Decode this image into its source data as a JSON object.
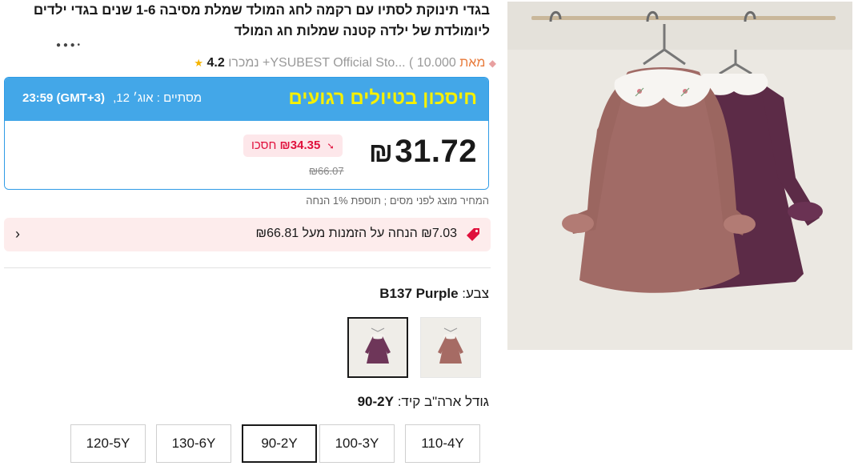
{
  "product": {
    "title": "בגדי תינוקת לסתיו עם רקמה לחג המולד שמלת מסיבה 1-6 שנים בגדי ילדים ליומולדת של ילדה קטנה שמלות חג המולד",
    "sold": "( 10.000+ נמכרו",
    "rating": "4.2",
    "store_name": "YSUBEST Official Sto...",
    "store_suffix": "מאת"
  },
  "sale": {
    "title": "חיסכון בטיולים רגועים",
    "ends_label": "מסתיים : אוג׳ 12,",
    "ends_time": "23:59 (GMT+3)",
    "price": "31.72",
    "currency": "₪",
    "save_amount": "₪34.35",
    "save_label": "חסכו",
    "old_price": "₪66.07"
  },
  "tax_note": "המחיר מוצג לפני מסים ; תוספת 1% הנחה",
  "coupon": {
    "text": "₪7.03 הנחה על הזמנות מעל ₪66.81"
  },
  "color": {
    "label": "צבע:",
    "selected": "B137 Purple"
  },
  "size": {
    "label": "גודל ארה\"ב קיד:",
    "selected": "90-2Y",
    "options": [
      "110-4Y",
      "100-3Y",
      "90-2Y",
      "130-6Y",
      "120-5Y"
    ]
  },
  "icons": {
    "star": "star-icon",
    "coupon": "tag-icon",
    "arrow": "chevron-left-icon",
    "down_arrow": "arrow-down-icon"
  },
  "colors": {
    "sale_header": "#43a7e8",
    "sale_title": "#f6f000",
    "save_red": "#e0103c",
    "coupon_bg": "#fdecec"
  }
}
